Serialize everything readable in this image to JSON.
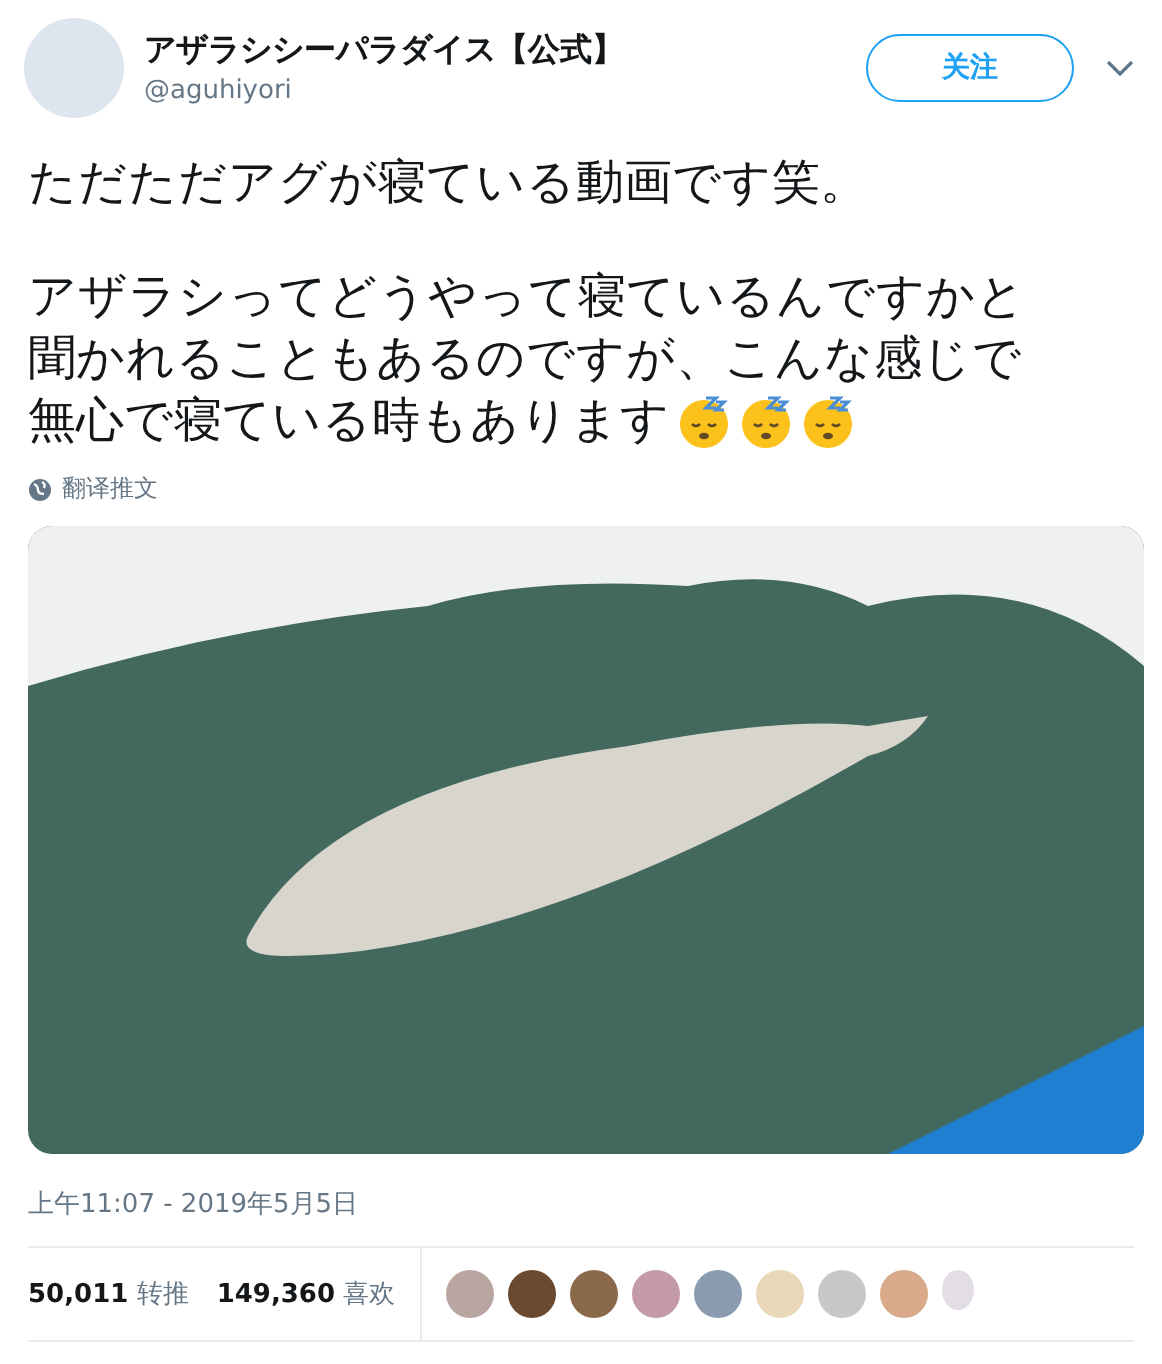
{
  "author": {
    "name": "アザラシシーパラダイス【公式】",
    "handle": "@aguhiyori"
  },
  "follow_button": "关注",
  "tweet_text": [
    [
      "ただただアグが寝ている動画です笑。"
    ],
    [
      "アザラシってどうやって寝ているんですかと",
      "聞かれることもあるのですが、こんな感じで",
      "無心で寝ている時もあります"
    ]
  ],
  "translate_link": "翻译推文",
  "timestamp": "上午11:07 - 2019年5月5日",
  "stats": [
    {
      "count": "50,011",
      "label": "转推"
    },
    {
      "count": "149,360",
      "label": "喜欢"
    }
  ]
}
